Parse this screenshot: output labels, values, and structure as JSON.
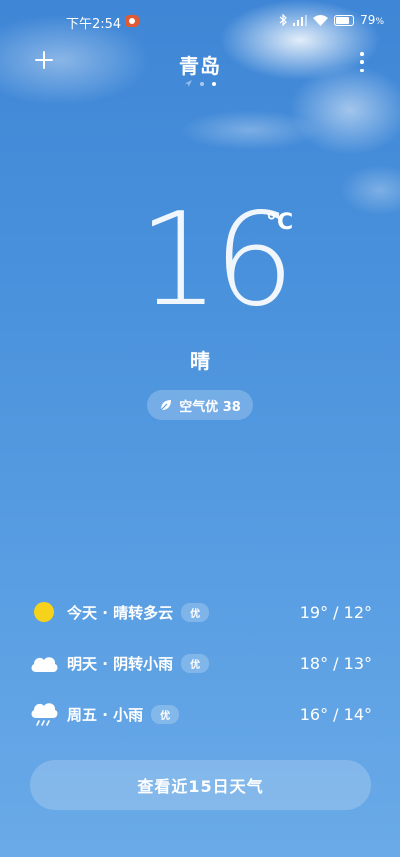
{
  "status_bar": {
    "time": "下午2:54",
    "battery_percent": "79",
    "battery_suffix": "%"
  },
  "header": {
    "city": "青岛",
    "page_count": 3,
    "active_page": 3
  },
  "current": {
    "temperature": "16",
    "unit": "°C",
    "condition": "晴",
    "aqi_label": "空气优 38"
  },
  "forecast": [
    {
      "icon": "sun-icon",
      "label": "今天 · 晴转多云",
      "aqi": "优",
      "temp": "19° / 12°"
    },
    {
      "icon": "cloud-icon",
      "label": "明天 · 阴转小雨",
      "aqi": "优",
      "temp": "18° / 13°"
    },
    {
      "icon": "rain-cloud-icon",
      "label": "周五 · 小雨",
      "aqi": "优",
      "temp": "16° / 14°"
    }
  ],
  "forecast_button": "查看近15日天气",
  "colors": {
    "sun": "#f7d21a",
    "record": "#e05a36",
    "background": "#4a92dc"
  }
}
